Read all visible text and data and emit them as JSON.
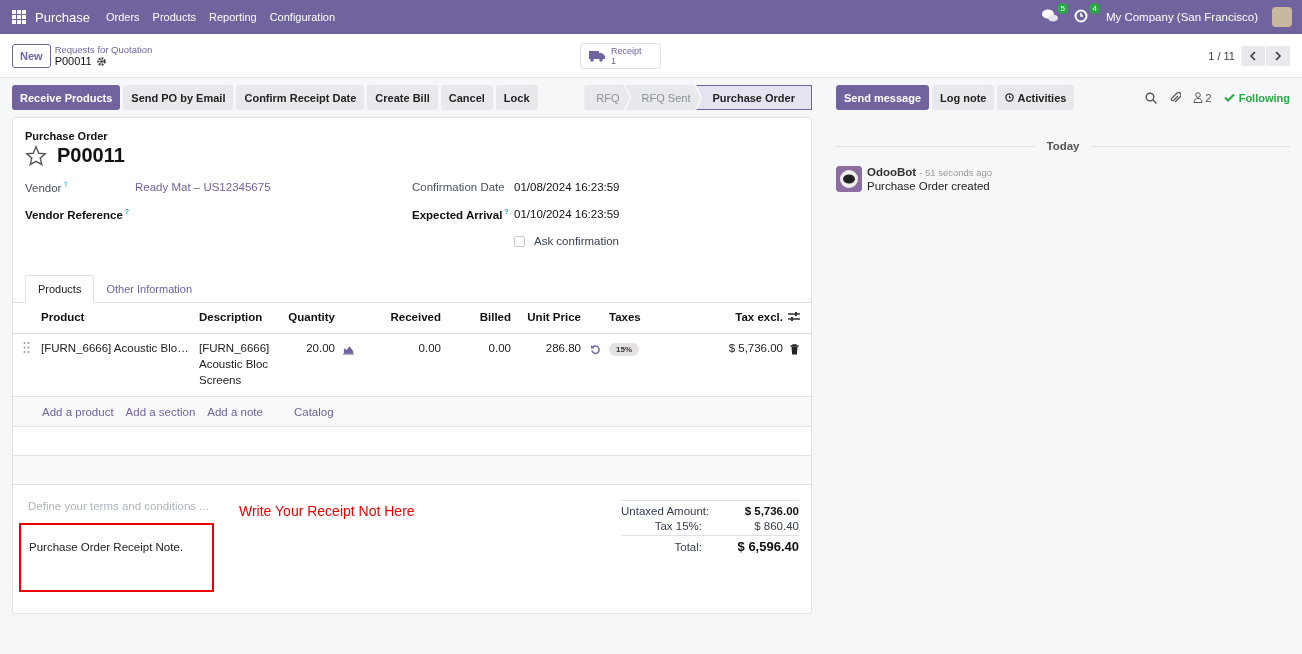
{
  "navbar": {
    "app_name": "Purchase",
    "menu": [
      "Orders",
      "Products",
      "Reporting",
      "Configuration"
    ],
    "messages_count": "5",
    "activities_count": "4",
    "company": "My Company (San Francisco)"
  },
  "control_panel": {
    "new_button": "New",
    "breadcrumb": "Requests for Quotation",
    "record": "P00011",
    "smart_button": {
      "label": "Receipt",
      "count": "1"
    },
    "pager": "1 / 11"
  },
  "status_bar": {
    "buttons": [
      {
        "label": "Receive Products",
        "primary": true
      },
      {
        "label": "Send PO by Email",
        "primary": false
      },
      {
        "label": "Confirm Receipt Date",
        "primary": false
      },
      {
        "label": "Create Bill",
        "primary": false
      },
      {
        "label": "Cancel",
        "primary": false
      },
      {
        "label": "Lock",
        "primary": false
      }
    ],
    "stages": [
      {
        "label": "RFQ",
        "selected": false
      },
      {
        "label": "RFQ Sent",
        "selected": false
      },
      {
        "label": "Purchase Order",
        "selected": true
      }
    ]
  },
  "form": {
    "title_label": "Purchase Order",
    "name": "P00011",
    "starred": false,
    "left_fields": [
      {
        "label": "Vendor",
        "help_mark": "?",
        "required": false,
        "value": "Ready Mat – US12345675",
        "link": true
      },
      {
        "label": "Vendor Reference",
        "help_mark": "?",
        "required": true
      }
    ],
    "right_fields": [
      {
        "label": "Confirmation Date",
        "required": false,
        "value": "01/08/2024 16:23:59",
        "link": false
      },
      {
        "label": "Expected Arrival",
        "help_mark": "?",
        "required": true,
        "value": "01/10/2024 16:23:59",
        "link": false
      }
    ],
    "ask_confirmation": {
      "label": "Ask confirmation",
      "checked": false
    },
    "tabs": [
      {
        "label": "Products",
        "selected": true
      },
      {
        "label": "Other Information",
        "selected": false
      }
    ],
    "table": {
      "columns": [
        "Product",
        "Description",
        "Quantity",
        "Received",
        "Billed",
        "Unit Price",
        "Taxes",
        "Tax excl."
      ],
      "rows": [
        {
          "product": "[FURN_6666] Acoustic Blo…",
          "description": "[FURN_6666] Acoustic Bloc Screens",
          "quantity": "20.00",
          "received": "0.00",
          "billed": "0.00",
          "unit_price": "286.80",
          "tax": "15%",
          "subtotal": "$ 5,736.00"
        }
      ],
      "add_links": [
        "Add a product",
        "Add a section",
        "Add a note",
        "Catalog"
      ]
    },
    "terms_placeholder": "Define your terms and conditions ...",
    "note": "Purchase Order Receipt Note.",
    "annotation": "Write Your Receipt Not Here",
    "totals": [
      {
        "label": "Untaxed Amount:",
        "value": "$ 5,736.00",
        "kind": "subtotal"
      },
      {
        "label": "Tax 15%:",
        "value": "$ 860.40",
        "kind": "tax"
      },
      {
        "label": "Total:",
        "value": "$ 6,596.40",
        "kind": "total"
      }
    ]
  },
  "chatter": {
    "buttons": [
      {
        "label": "Send message",
        "primary": true
      },
      {
        "label": "Log note",
        "primary": false
      },
      {
        "label": "Activities",
        "primary": false
      }
    ],
    "followers": "2",
    "following": "Following",
    "date": "Today",
    "messages": [
      {
        "author": "OdooBot",
        "time": "- 51 seconds ago",
        "body": "Purchase Order created"
      }
    ]
  }
}
